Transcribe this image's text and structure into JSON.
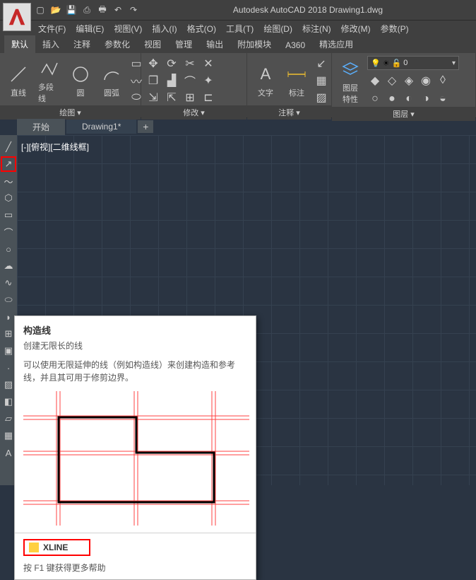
{
  "title": "Autodesk AutoCAD 2018   Drawing1.dwg",
  "menus": {
    "file": "文件(F)",
    "edit": "编辑(E)",
    "view": "视图(V)",
    "insert": "插入(I)",
    "format": "格式(O)",
    "tools": "工具(T)",
    "draw": "绘图(D)",
    "dimension": "标注(N)",
    "modify": "修改(M)",
    "param": "参数(P)"
  },
  "ribbon_tabs": {
    "default": "默认",
    "insert": "插入",
    "annotate": "注释",
    "parametric": "参数化",
    "view": "视图",
    "manage": "管理",
    "output": "输出",
    "addins": "附加模块",
    "a360": "A360",
    "featured": "精选应用"
  },
  "ribbon": {
    "draw": {
      "line": "直线",
      "polyline": "多段线",
      "circle": "圆",
      "arc": "圆弧",
      "title": "绘图 ▾"
    },
    "modify": {
      "title": "修改 ▾"
    },
    "annotate": {
      "text": "文字",
      "dim": "标注",
      "title": "注释 ▾"
    },
    "layers": {
      "prop": "图层\n特性",
      "zero": "0",
      "title": "图层 ▾"
    }
  },
  "filetabs": {
    "start": "开始",
    "drawing": "Drawing1*"
  },
  "viewport_label": "[-][俯视][二维线框]",
  "tooltip": {
    "title": "构造线",
    "subtitle": "创建无限长的线",
    "desc": "可以使用无限延伸的线（例如构造线）来创建构造和参考线，并且其可用于修剪边界。",
    "command": "XLINE",
    "help": "按 F1 键获得更多帮助"
  }
}
